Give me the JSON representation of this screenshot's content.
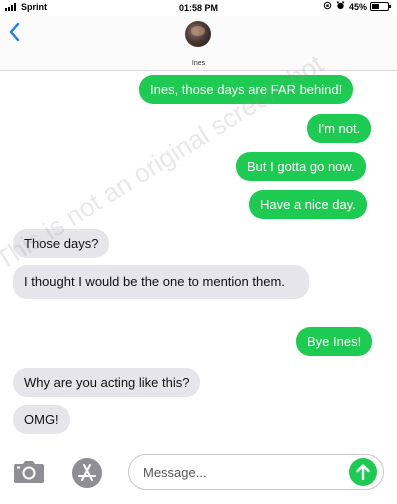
{
  "status_bar": {
    "carrier": "Sprint",
    "time": "01:58 PM",
    "battery": "45%",
    "battery_level": 0.45
  },
  "header": {
    "back_icon": "chevron-left-icon",
    "contact_name": "Ines"
  },
  "messages": [
    {
      "from": "me",
      "text": "Ines, those days are FAR behind!"
    },
    {
      "from": "me",
      "text": "I'm not."
    },
    {
      "from": "me",
      "text": "But I gotta go now."
    },
    {
      "from": "me",
      "text": "Have a nice day."
    },
    {
      "from": "them",
      "text": "Those days?"
    },
    {
      "from": "them",
      "text": "I thought I would be the one to mention them."
    },
    {
      "from": "me",
      "text": "Bye Ines!"
    },
    {
      "from": "them",
      "text": "Why are you acting like this?"
    },
    {
      "from": "them",
      "text": "OMG!"
    }
  ],
  "watermark": "This is not an original screenshot",
  "composer": {
    "placeholder": "Message...",
    "camera_icon": "camera-icon",
    "apps_icon": "app-store-icon",
    "send_icon": "arrow-up-icon"
  },
  "colors": {
    "sent_bubble": "#1ecb52",
    "received_bubble": "#e6e5eb",
    "link_blue": "#1a7cf5"
  }
}
